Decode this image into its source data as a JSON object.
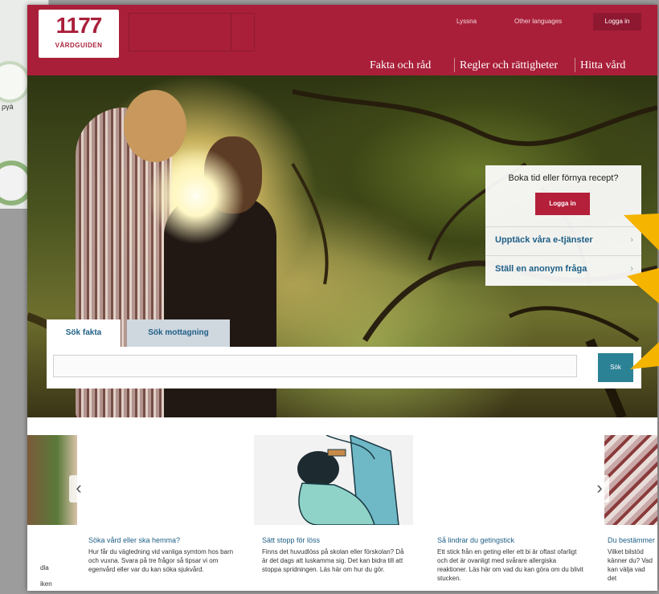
{
  "brand": {
    "number": "1177",
    "name": "VÅRDGUIDEN",
    "color": "#a91f39"
  },
  "header": {
    "top_links": [
      "Lyssna",
      "Other languages"
    ],
    "login_label": "Logga in",
    "nav": [
      "Fakta och råd",
      "Regler och rättigheter",
      "Hitta vård"
    ]
  },
  "background_window": {
    "text": "ργà"
  },
  "panel": {
    "question": "Boka tid eller förnya recept?",
    "login_label": "Logga in",
    "links": [
      "Upptäck våra e-tjänster",
      "Ställ en anonym fråga"
    ]
  },
  "search": {
    "tabs": [
      "Sök fakta",
      "Sök mottagning"
    ],
    "button_label": "Sök"
  },
  "carousel": {
    "cards": [
      {
        "title": "",
        "text": ""
      },
      {
        "title": "Söka vård eller ska hemma?",
        "text": "Hur får du vägledning vid vanliga symtom hos barn och vuxna. Svara på tre frågor så tipsar vi om egenvård eller var du kan söka sjukvård."
      },
      {
        "title": "Sätt stopp för löss",
        "text": "Finns det huvudlöss på skolan eller förskolan? Då är det dags att luskamma sig. Det kan bidra till att stoppa spridningen. Läs här om hur du gör."
      },
      {
        "title": "Så lindrar du getingstick",
        "text": "Ett stick från en geting eller ett bi är oftast ofarligt och det är ovanligt med svårare allergiska reaktioner. Läs här om vad du kan göra om du blivit stucken."
      },
      {
        "title": "Du bestämmer",
        "text": "Vilket bilstöd känner du? Vad kan välja vad det"
      }
    ],
    "left_fragment": [
      "dla",
      "iken"
    ]
  },
  "colors": {
    "accent": "#a91f39",
    "link": "#1e5f86",
    "search_button": "#2b8295",
    "arrow": "#f5b400"
  }
}
